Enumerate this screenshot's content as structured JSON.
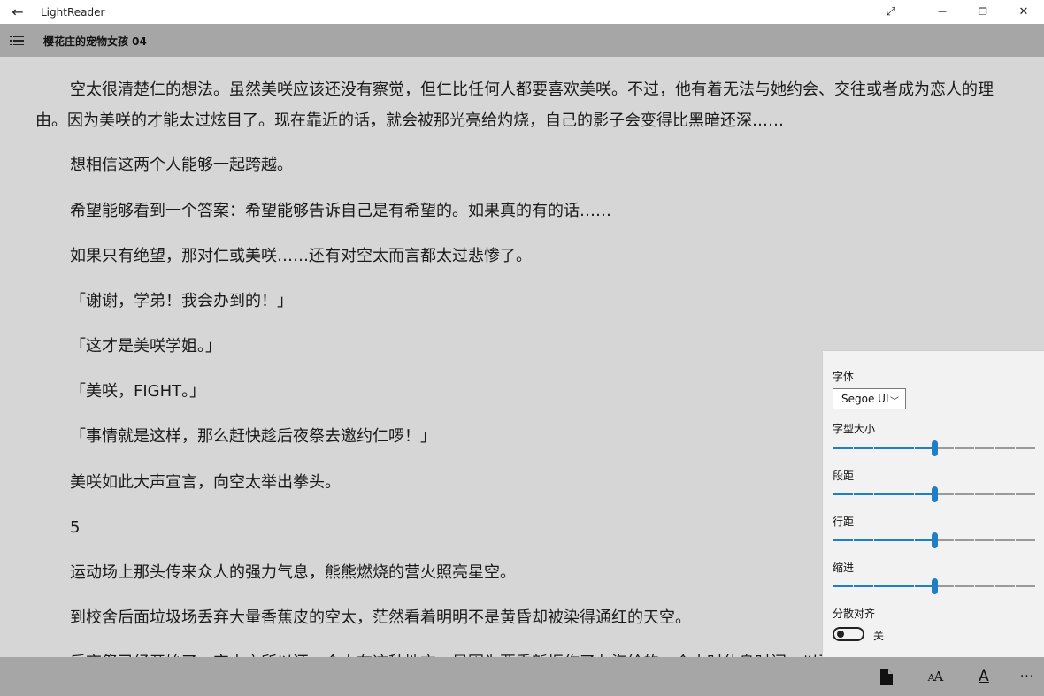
{
  "window": {
    "title": "LightReader",
    "back_glyph": "←",
    "fullscreen_glyph": "⤢",
    "minimize_glyph": "—",
    "restore_glyph": "❐",
    "close_glyph": "✕"
  },
  "header": {
    "chapter_title": "樱花庄的宠物女孩 04"
  },
  "content": {
    "paragraphs": [
      "空太很清楚仁的想法。虽然美咲应该还没有察觉，但仁比任何人都要喜欢美咲。不过，他有着无法与她约会、交往或者成为恋人的理由。因为美咲的才能太过炫目了。现在靠近的话，就会被那光亮给灼烧，自己的影子会变得比黑暗还深……",
      "想相信这两个人能够一起跨越。",
      "希望能够看到一个答案：希望能够告诉自己是有希望的。如果真的有的话……",
      "如果只有绝望，那对仁或美咲……还有对空太而言都太过悲惨了。",
      "「谢谢，学弟！我会办到的！」",
      "「这才是美咲学姐。」",
      "「美咲，FIGHT。」",
      "「事情就是这样，那么赶快趁后夜祭去邀约仁啰！」",
      "美咲如此大声宣言，向空太举出拳头。",
      "5",
      "运动场上那头传来众人的强力气息，熊熊燃烧的营火照亮星空。",
      "到校舍后面垃圾场丢弃大量香蕉皮的空太，茫然看着明明不是黄昏却被染得通红的天空。",
      "后夜祭已经开始了。空太之所以还一个人在这种地方，是因为要重新振作了七海给的一个小时休息时间，以及那些都很开心"
    ]
  },
  "settings": {
    "font_label": "字体",
    "font_value": "Segoe UI",
    "font_size_label": "字型大小",
    "font_size_level": 0.5,
    "paragraph_spacing_label": "段距",
    "paragraph_spacing_level": 0.5,
    "line_spacing_label": "行距",
    "line_spacing_level": 0.5,
    "indent_label": "缩进",
    "indent_level": 0.5,
    "justify_label": "分散对齐",
    "justify_state": "关"
  },
  "appbar": {
    "more_glyph": "···"
  },
  "colors": {
    "accent": "#1f7fc4",
    "background": "#d6d6d6",
    "bars": "#a6a6a6",
    "panel": "#f2f2f2"
  }
}
